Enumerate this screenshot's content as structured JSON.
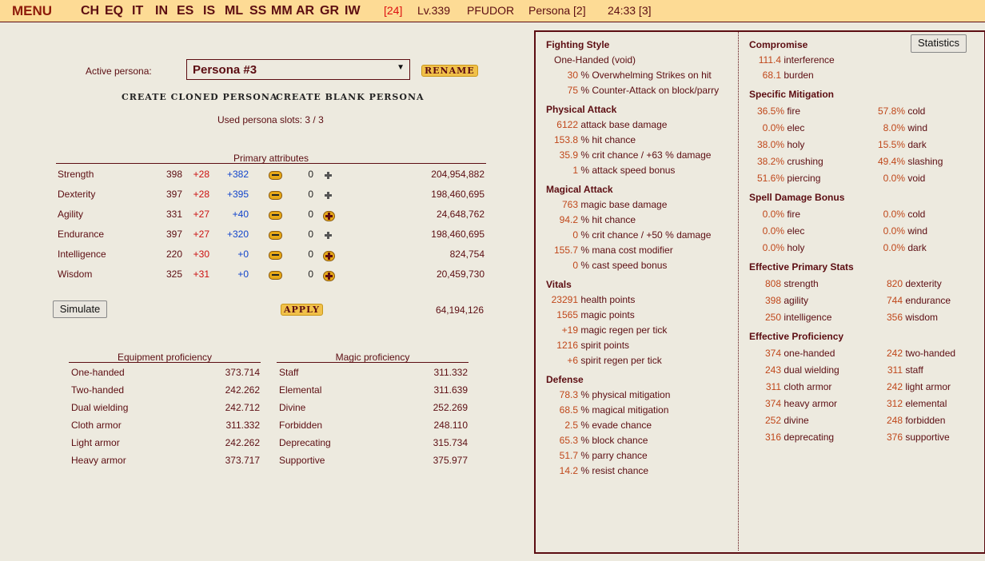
{
  "topbar": {
    "menu": "MENU",
    "nav": [
      "CH",
      "EQ",
      "IT",
      "IN",
      "ES",
      "IS",
      "ML",
      "SS",
      "MM",
      "AR",
      "GR",
      "IW"
    ],
    "alert": "[24]",
    "level": "Lv.339",
    "player": "PFUDOR",
    "persona": "Persona [2]",
    "time": "24:33 [3]"
  },
  "persona": {
    "active_label": "Active persona:",
    "selected": "Persona #3",
    "rename": "RENAME",
    "create_cloned": "CREATE CLONED PERSONA",
    "create_blank": "CREATE BLANK PERSONA",
    "slots": "Used persona slots: 3 / 3"
  },
  "primary": {
    "caption": "Primary attributes",
    "rows": [
      {
        "name": "Strength",
        "base": "398",
        "plus": "+28",
        "bonus": "+382",
        "zero": "0",
        "exp": "204,954,882",
        "can_add": false
      },
      {
        "name": "Dexterity",
        "base": "397",
        "plus": "+28",
        "bonus": "+395",
        "zero": "0",
        "exp": "198,460,695",
        "can_add": false
      },
      {
        "name": "Agility",
        "base": "331",
        "plus": "+27",
        "bonus": "+40",
        "zero": "0",
        "exp": "24,648,762",
        "can_add": true
      },
      {
        "name": "Endurance",
        "base": "397",
        "plus": "+27",
        "bonus": "+320",
        "zero": "0",
        "exp": "198,460,695",
        "can_add": false
      },
      {
        "name": "Intelligence",
        "base": "220",
        "plus": "+30",
        "bonus": "+0",
        "zero": "0",
        "exp": "824,754",
        "can_add": true
      },
      {
        "name": "Wisdom",
        "base": "325",
        "plus": "+31",
        "bonus": "+0",
        "zero": "0",
        "exp": "20,459,730",
        "can_add": true
      }
    ],
    "simulate": "Simulate",
    "apply": "APPLY",
    "total": "64,194,126"
  },
  "equipment": {
    "caption": "Equipment proficiency",
    "rows": [
      {
        "name": "One-handed",
        "value": "373.714"
      },
      {
        "name": "Two-handed",
        "value": "242.262"
      },
      {
        "name": "Dual wielding",
        "value": "242.712"
      },
      {
        "name": "Cloth armor",
        "value": "311.332"
      },
      {
        "name": "Light armor",
        "value": "242.262"
      },
      {
        "name": "Heavy armor",
        "value": "373.717"
      }
    ]
  },
  "magic": {
    "caption": "Magic proficiency",
    "rows": [
      {
        "name": "Staff",
        "value": "311.332"
      },
      {
        "name": "Elemental",
        "value": "311.639"
      },
      {
        "name": "Divine",
        "value": "252.269"
      },
      {
        "name": "Forbidden",
        "value": "248.110"
      },
      {
        "name": "Deprecating",
        "value": "315.734"
      },
      {
        "name": "Supportive",
        "value": "375.977"
      }
    ]
  },
  "stats": {
    "button": "Statistics",
    "fighting_style": {
      "title": "Fighting Style",
      "style": "One-Handed (void)",
      "lines": [
        {
          "num": "30",
          "text": "% Overwhelming Strikes on hit"
        },
        {
          "num": "75",
          "text": "% Counter-Attack on block/parry"
        }
      ]
    },
    "physical": {
      "title": "Physical Attack",
      "lines": [
        {
          "num": "6122",
          "text": "attack base damage"
        },
        {
          "num": "153.8",
          "text": "% hit chance"
        },
        {
          "num": "35.9",
          "text": "% crit chance / +63 % damage"
        },
        {
          "num": "1",
          "text": "% attack speed bonus"
        }
      ]
    },
    "magical": {
      "title": "Magical Attack",
      "lines": [
        {
          "num": "763",
          "text": "magic base damage"
        },
        {
          "num": "94.2",
          "text": "% hit chance"
        },
        {
          "num": "0",
          "text": "% crit chance / +50 % damage"
        },
        {
          "num": "155.7",
          "text": "% mana cost modifier"
        },
        {
          "num": "0",
          "text": "% cast speed bonus"
        }
      ]
    },
    "vitals": {
      "title": "Vitals",
      "lines": [
        {
          "num": "23291",
          "text": "health points"
        },
        {
          "num": "1565",
          "text": "magic points"
        },
        {
          "num": "+19",
          "text": "magic regen per tick"
        },
        {
          "num": "1216",
          "text": "spirit points"
        },
        {
          "num": "+6",
          "text": "spirit regen per tick"
        }
      ]
    },
    "defense": {
      "title": "Defense",
      "lines": [
        {
          "num": "78.3",
          "text": "% physical mitigation"
        },
        {
          "num": "68.5",
          "text": "% magical mitigation"
        },
        {
          "num": "2.5",
          "text": "% evade chance"
        },
        {
          "num": "65.3",
          "text": "% block chance"
        },
        {
          "num": "51.7",
          "text": "% parry chance"
        },
        {
          "num": "14.2",
          "text": "% resist chance"
        }
      ]
    },
    "compromise": {
      "title": "Compromise",
      "lines": [
        {
          "num": "111.4",
          "text": "interference"
        },
        {
          "num": "68.1",
          "text": "burden"
        }
      ]
    },
    "mitigation": {
      "title": "Specific Mitigation",
      "rows": [
        [
          {
            "num": "36.5%",
            "text": "fire"
          },
          {
            "num": "57.8%",
            "text": "cold"
          }
        ],
        [
          {
            "num": "0.0%",
            "text": "elec"
          },
          {
            "num": "8.0%",
            "text": "wind"
          }
        ],
        [
          {
            "num": "38.0%",
            "text": "holy"
          },
          {
            "num": "15.5%",
            "text": "dark"
          }
        ],
        [
          {
            "num": "38.2%",
            "text": "crushing"
          },
          {
            "num": "49.4%",
            "text": "slashing"
          }
        ],
        [
          {
            "num": "51.6%",
            "text": "piercing"
          },
          {
            "num": "0.0%",
            "text": "void"
          }
        ]
      ]
    },
    "spell_bonus": {
      "title": "Spell Damage Bonus",
      "rows": [
        [
          {
            "num": "0.0%",
            "text": "fire"
          },
          {
            "num": "0.0%",
            "text": "cold"
          }
        ],
        [
          {
            "num": "0.0%",
            "text": "elec"
          },
          {
            "num": "0.0%",
            "text": "wind"
          }
        ],
        [
          {
            "num": "0.0%",
            "text": "holy"
          },
          {
            "num": "0.0%",
            "text": "dark"
          }
        ]
      ]
    },
    "eff_primary": {
      "title": "Effective Primary Stats",
      "rows": [
        [
          {
            "num": "808",
            "text": "strength"
          },
          {
            "num": "820",
            "text": "dexterity"
          }
        ],
        [
          {
            "num": "398",
            "text": "agility"
          },
          {
            "num": "744",
            "text": "endurance"
          }
        ],
        [
          {
            "num": "250",
            "text": "intelligence"
          },
          {
            "num": "356",
            "text": "wisdom"
          }
        ]
      ]
    },
    "eff_prof": {
      "title": "Effective Proficiency",
      "rows": [
        [
          {
            "num": "374",
            "text": "one-handed"
          },
          {
            "num": "242",
            "text": "two-handed"
          }
        ],
        [
          {
            "num": "243",
            "text": "dual wielding"
          },
          {
            "num": "311",
            "text": "staff"
          }
        ],
        [
          {
            "num": "311",
            "text": "cloth armor"
          },
          {
            "num": "242",
            "text": "light armor"
          }
        ],
        [
          {
            "num": "374",
            "text": "heavy armor"
          },
          {
            "num": "312",
            "text": "elemental"
          }
        ],
        [
          {
            "num": "252",
            "text": "divine"
          },
          {
            "num": "248",
            "text": "forbidden"
          }
        ],
        [
          {
            "num": "316",
            "text": "deprecating"
          },
          {
            "num": "376",
            "text": "supportive"
          }
        ]
      ]
    }
  }
}
